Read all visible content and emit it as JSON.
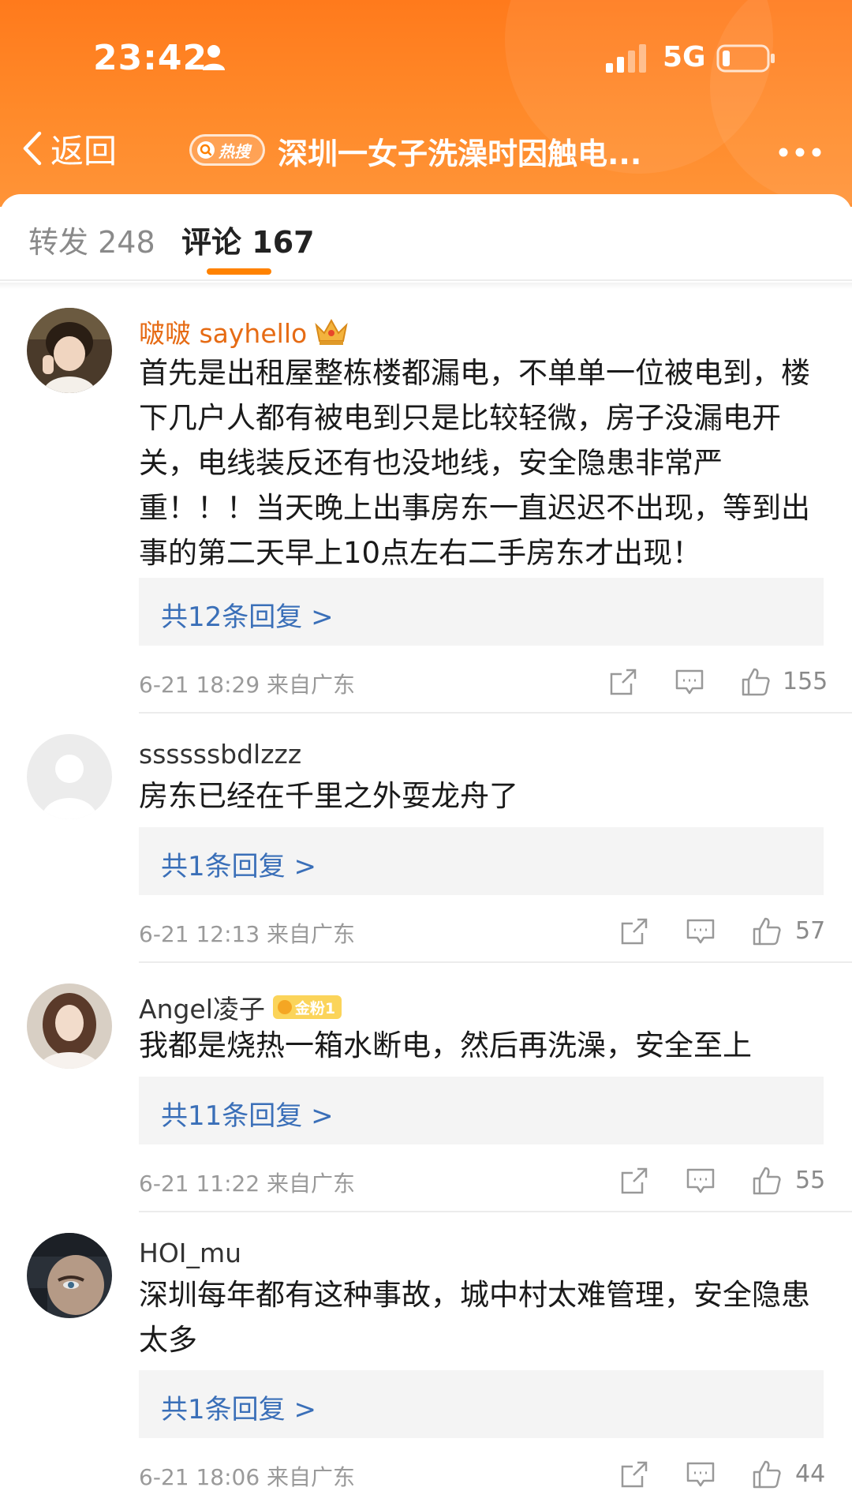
{
  "status_bar": {
    "time": "23:42",
    "network": "5G"
  },
  "nav": {
    "back_label": "返回",
    "hot_badge": "热搜",
    "title": "深圳一女子洗澡时因触电..."
  },
  "tabs": [
    {
      "label": "转发",
      "count": "248",
      "active": false
    },
    {
      "label": "评论",
      "count": "167",
      "active": true
    }
  ],
  "comments": [
    {
      "username": "啵啵 sayhello",
      "badge": "crown",
      "text": "首先是出租屋整栋楼都漏电，不单单一位被电到，楼下几户人都有被电到只是比较轻微，房子没漏电开关，电线装反还有也没地线，安全隐患非常严重！！！当天晚上出事房东一直迟迟不出现，等到出事的第二天早上10点左右二手房东才出现！",
      "replies": "共12条回复 >",
      "time": "6-21 18:29",
      "location": "来自广东",
      "likes": "155"
    },
    {
      "username": "ssssssbdlzzz",
      "badge": "",
      "text": "房东已经在千里之外耍龙舟了",
      "replies": "共1条回复 >",
      "time": "6-21 12:13",
      "location": "来自广东",
      "likes": "57"
    },
    {
      "username": "Angel凌子",
      "badge": "金粉1",
      "text": "我都是烧热一箱水断电，然后再洗澡，安全至上",
      "replies": "共11条回复 >",
      "time": "6-21 11:22",
      "location": "来自广东",
      "likes": "55"
    },
    {
      "username": "HOI_mu",
      "badge": "",
      "text": "深圳每年都有这种事故，城中村太难管理，安全隐患太多",
      "replies": "共1条回复 >",
      "time": "6-21 18:06",
      "location": "来自广东",
      "likes": "44"
    }
  ],
  "colors": {
    "header": "#ff8200",
    "accent": "#ff8200",
    "link": "#3a6fb8",
    "vip_name": "#e66b14"
  },
  "icons": [
    "person-icon",
    "signal-icon",
    "battery-icon",
    "back-chevron-icon",
    "search-icon",
    "more-icon",
    "crown-icon",
    "share-icon",
    "comment-icon",
    "like-icon"
  ]
}
